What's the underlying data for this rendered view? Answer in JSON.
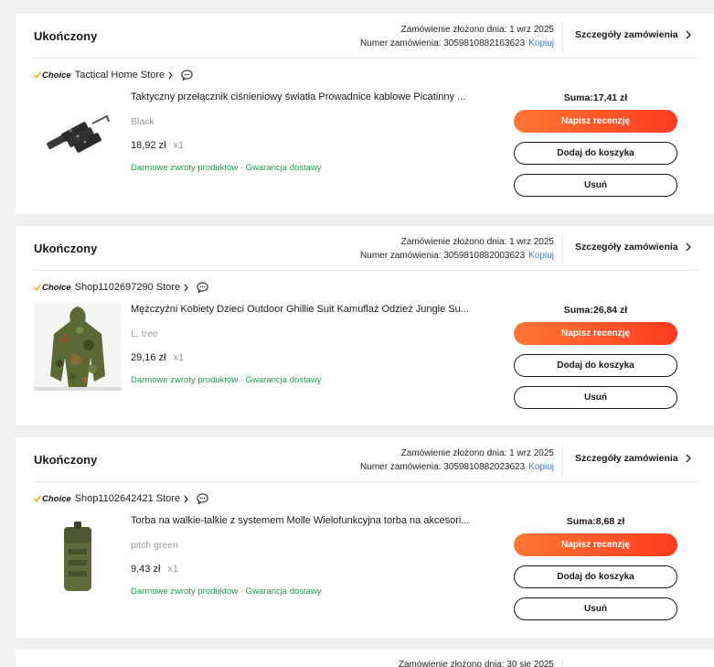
{
  "orders": [
    {
      "status": "Ukończony",
      "date_line": "Zamówienie złożono dnia: 1 wrz 2025",
      "number_line": "Numer zamówienia: 3059810882163623",
      "copy_label": "Kopiuj",
      "details_label": "Szczegóły zamówienia",
      "choice_label": "Choice",
      "store": "Tactical Home Store",
      "title": "Taktyczny przełącznik ciśnieniowy światła Prowadnice kablowe Picatinny ...",
      "variant": "Black",
      "price": "18,92 zł",
      "qty": "x1",
      "guarantee": "Darmowe zwroty produktów · Gwarancja dostawy",
      "sum": "Suma:17,41 zł",
      "review_label": "Napisz recenzję",
      "cart_label": "Dodaj do koszyka",
      "remove_label": "Usuń",
      "image_icon": "switch-rail-icon"
    },
    {
      "status": "Ukończony",
      "date_line": "Zamówienie złożono dnia: 1 wrz 2025",
      "number_line": "Numer zamówienia: 3059810882003623",
      "copy_label": "Kopiuj",
      "details_label": "Szczegóły zamówienia",
      "choice_label": "Choice",
      "store": "Shop1102697290 Store",
      "title": "Mężczyźni Kobiety Dzieci Outdoor Ghillie Suit Kamuflaż Odzież Jungle Su...",
      "variant": "L, tree",
      "price": "29,16 zł",
      "qty": "x1",
      "guarantee": "Darmowe zwroty produktów · Gwarancja dostawy",
      "sum": "Suma:26,84 zł",
      "review_label": "Napisz recenzję",
      "cart_label": "Dodaj do koszyka",
      "remove_label": "Usuń",
      "image_icon": "ghillie-suit-icon"
    },
    {
      "status": "Ukończony",
      "date_line": "Zamówienie złożono dnia: 1 wrz 2025",
      "number_line": "Numer zamówienia: 3059810882023623",
      "copy_label": "Kopiuj",
      "details_label": "Szczegóły zamówienia",
      "choice_label": "Choice",
      "store": "Shop1102642421 Store",
      "title": "Torba na walkie-talkie z systemem Molle Wielofunkcyjna torba na akcesori...",
      "variant": "pitch green",
      "price": "9,43 zł",
      "qty": "x1",
      "guarantee": "Darmowe zwroty produktów · Gwarancja dostawy",
      "sum": "Suma:8,68 zł",
      "review_label": "Napisz recenzję",
      "cart_label": "Dodaj do koszyka",
      "remove_label": "Usuń",
      "image_icon": "radio-pouch-icon"
    }
  ],
  "partial_order": {
    "date_line": "Zamówienie złożono dnia: 30 sie 2025"
  },
  "colors": {
    "accent_gradient_start": "#ff7733",
    "accent_gradient_end": "#ff3b1f",
    "link_blue": "#2e7cf6",
    "guarantee_green": "#1a9a4b",
    "choice_tick": "#f5a623"
  }
}
